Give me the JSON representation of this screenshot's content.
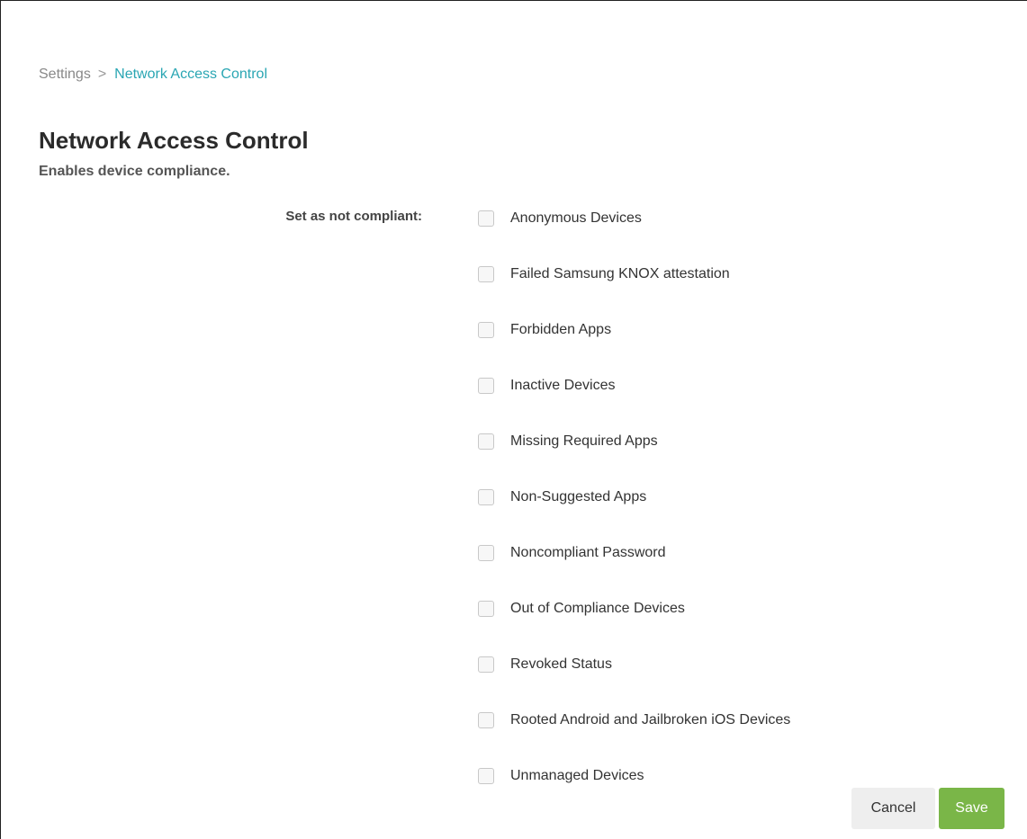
{
  "breadcrumb": {
    "parent": "Settings",
    "separator": ">",
    "current": "Network Access Control"
  },
  "page": {
    "title": "Network Access Control",
    "subtitle": "Enables device compliance."
  },
  "form": {
    "label": "Set as not compliant:",
    "options": [
      {
        "label": "Anonymous Devices",
        "checked": false
      },
      {
        "label": "Failed Samsung KNOX attestation",
        "checked": false
      },
      {
        "label": "Forbidden Apps",
        "checked": false
      },
      {
        "label": "Inactive Devices",
        "checked": false
      },
      {
        "label": "Missing Required Apps",
        "checked": false
      },
      {
        "label": "Non-Suggested Apps",
        "checked": false
      },
      {
        "label": "Noncompliant Password",
        "checked": false
      },
      {
        "label": "Out of Compliance Devices",
        "checked": false
      },
      {
        "label": "Revoked Status",
        "checked": false
      },
      {
        "label": "Rooted Android and Jailbroken iOS Devices",
        "checked": false
      },
      {
        "label": "Unmanaged Devices",
        "checked": false
      }
    ]
  },
  "actions": {
    "cancel_label": "Cancel",
    "save_label": "Save"
  },
  "colors": {
    "accent": "#2aa6b3",
    "save_button": "#7ab648",
    "cancel_button": "#eeeeee"
  }
}
